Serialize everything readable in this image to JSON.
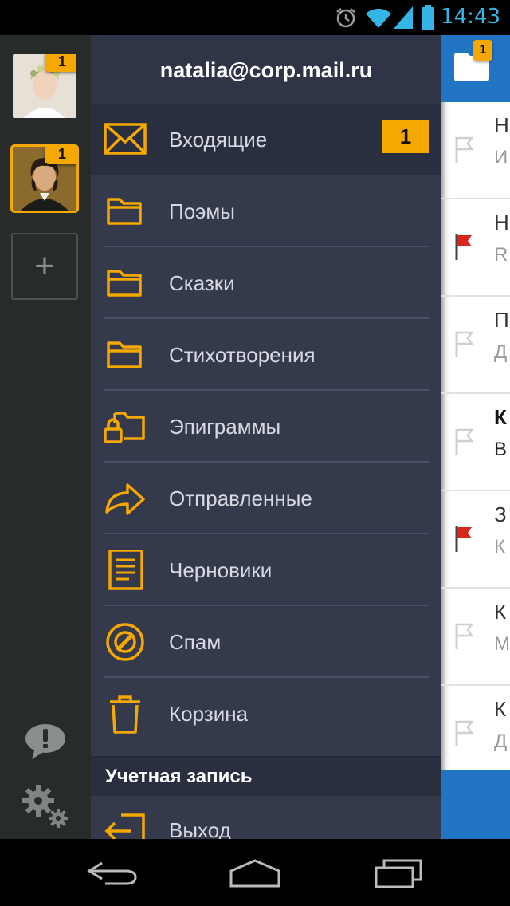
{
  "status_bar": {
    "time": "14:43"
  },
  "accounts": {
    "items": [
      {
        "badge": "1",
        "active": false
      },
      {
        "badge": "1",
        "active": true
      }
    ],
    "add_label": "+"
  },
  "menu": {
    "email": "natalia@corp.mail.ru",
    "items": [
      {
        "label": "Входящие",
        "icon": "envelope-icon",
        "badge": "1"
      },
      {
        "label": "Поэмы",
        "icon": "folder-icon"
      },
      {
        "label": "Сказки",
        "icon": "folder-icon"
      },
      {
        "label": "Стихотворения",
        "icon": "folder-icon"
      },
      {
        "label": "Эпиграммы",
        "icon": "locked-folder-icon"
      },
      {
        "label": "Отправленные",
        "icon": "forward-arrow-icon"
      },
      {
        "label": "Черновики",
        "icon": "document-icon"
      },
      {
        "label": "Спам",
        "icon": "spam-icon"
      },
      {
        "label": "Корзина",
        "icon": "trash-icon"
      }
    ],
    "section_label": "Учетная запись",
    "logout_label": "Выход"
  },
  "right_pane": {
    "folder_badge": "1",
    "rows": [
      {
        "l1": "Н",
        "l2": "И",
        "flagged": false
      },
      {
        "l1": "Н",
        "l2": "R",
        "flagged": true
      },
      {
        "l1": "П",
        "l2": "Д",
        "flagged": false
      },
      {
        "l1": "К",
        "l2": "В",
        "flagged": false,
        "unread": true
      },
      {
        "l1": "З",
        "l2": "К",
        "flagged": true
      },
      {
        "l1": "К",
        "l2": "М",
        "flagged": false
      },
      {
        "l1": "К",
        "l2": "Д",
        "flagged": false
      }
    ]
  },
  "colors": {
    "accent": "#f5a800",
    "menu_bg": "#343a4c",
    "rail_bg": "#272b2a",
    "blue": "#2175c2",
    "flag_red": "#d9261c"
  }
}
